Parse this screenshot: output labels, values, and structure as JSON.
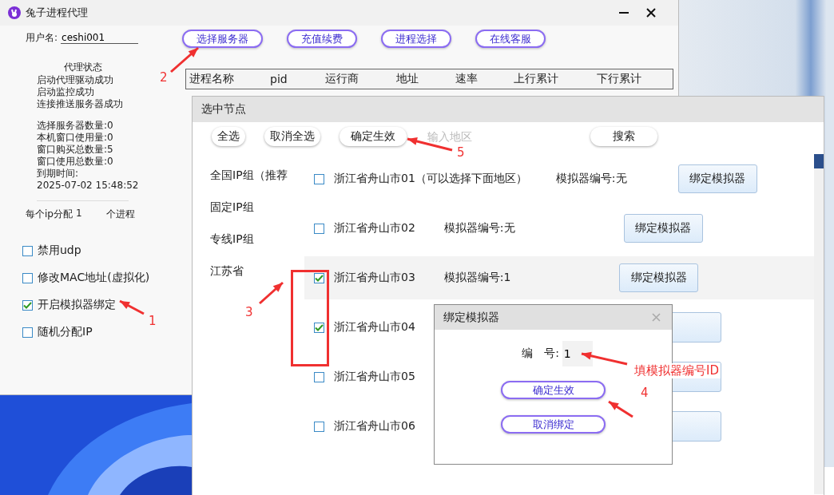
{
  "main_window": {
    "title": "兔子进程代理"
  },
  "account": {
    "label": "用户名:",
    "value": "ceshi001"
  },
  "status": {
    "title": "代理状态",
    "lines": [
      "启动代理驱动成功",
      "启动监控成功",
      "连接推送服务器成功"
    ],
    "stats": [
      "选择服务器数量:0",
      "本机窗口使用量:0",
      "窗口购买总数量:5",
      "窗口使用总数量:0",
      "到期时间:",
      "2025-07-02 15:48:52"
    ]
  },
  "per_ip": {
    "label": "每个ip分配",
    "value": "1",
    "unit": "个进程"
  },
  "options": [
    {
      "label": "禁用udp",
      "checked": false
    },
    {
      "label": "修改MAC地址(虚拟化)",
      "checked": false
    },
    {
      "label": "开启模拟器绑定",
      "checked": true
    },
    {
      "label": "随机分配IP",
      "checked": false
    }
  ],
  "toolbar_buttons": [
    "选择服务器",
    "充值续费",
    "进程选择",
    "在线客服"
  ],
  "process_table": {
    "columns": [
      "进程名称",
      "pid",
      "运行商",
      "地址",
      "速率",
      "上行累计",
      "下行累计"
    ]
  },
  "node_window": {
    "title": "选中节点",
    "actions": [
      "全选",
      "取消全选",
      "确定生效"
    ],
    "region_search": {
      "placeholder": "输入地区",
      "button": "搜索"
    },
    "groups": [
      "全国IP组（推荐",
      "固定IP组",
      "专线IP组",
      "江苏省"
    ],
    "nodes": [
      {
        "label": "浙江省舟山市01（可以选择下面地区）",
        "emulator": "模拟器编号:无",
        "button": "绑定模拟器",
        "checked": false,
        "selected": false
      },
      {
        "label": "浙江省舟山市02",
        "emulator": "模拟器编号:无",
        "button": "绑定模拟器",
        "checked": false,
        "selected": false
      },
      {
        "label": "浙江省舟山市03",
        "emulator": "模拟器编号:1",
        "button": "绑定模拟器",
        "checked": true,
        "selected": true
      },
      {
        "label": "浙江省舟山市04",
        "checked": true,
        "selected": false
      },
      {
        "label": "浙江省舟山市05",
        "checked": false,
        "selected": false
      },
      {
        "label": "浙江省舟山市06",
        "checked": false,
        "selected": false
      }
    ]
  },
  "dialog": {
    "title": "绑定模拟器",
    "field": {
      "label": "编　号:",
      "value": "1"
    },
    "buttons": [
      "确定生效",
      "取消绑定"
    ]
  },
  "annotations": [
    {
      "label": "1"
    },
    {
      "label": "2"
    },
    {
      "label": "3"
    },
    {
      "label": "4"
    },
    {
      "label": "5"
    }
  ],
  "note": "填模拟器编号ID"
}
